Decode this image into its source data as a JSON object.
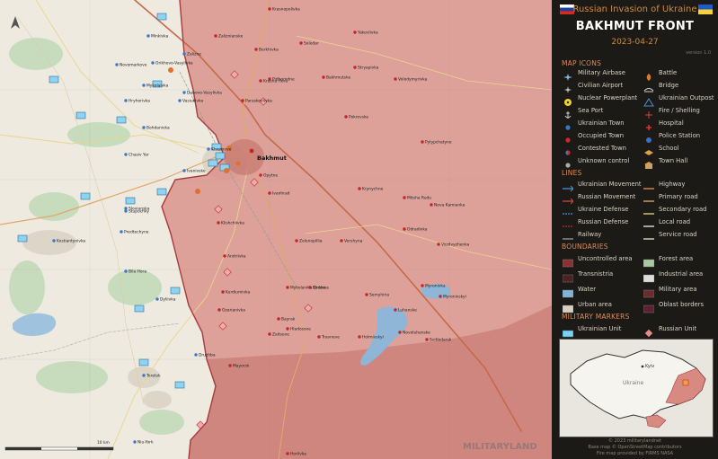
{
  "header": {
    "subtitle": "Russian Invasion of Ukraine",
    "title": "BAKHMUT FRONT",
    "date": "2023-04-27",
    "version": "version 1.0"
  },
  "legend": {
    "map_icons_heading": "MAP ICONS",
    "map_icons": [
      {
        "label": "Military Airbase",
        "icon": "airbase-icon"
      },
      {
        "label": "Battle",
        "icon": "battle-icon"
      },
      {
        "label": "Civilian Airport",
        "icon": "airport-icon"
      },
      {
        "label": "Bridge",
        "icon": "bridge-icon"
      },
      {
        "label": "Nuclear Powerplant",
        "icon": "nuclear-icon"
      },
      {
        "label": "Ukrainian Outpost",
        "icon": "outpost-icon"
      },
      {
        "label": "Sea Port",
        "icon": "anchor-icon"
      },
      {
        "label": "Fire / Shelling",
        "icon": "fire-icon"
      },
      {
        "label": "Ukrainian Town",
        "icon": "blue-dot-icon"
      },
      {
        "label": "Hospital",
        "icon": "hospital-icon"
      },
      {
        "label": "Occupied Town",
        "icon": "red-dot-icon"
      },
      {
        "label": "Police Station",
        "icon": "police-icon"
      },
      {
        "label": "Contested Town",
        "icon": "contested-dot-icon"
      },
      {
        "label": "School",
        "icon": "school-icon"
      },
      {
        "label": "Unknown control",
        "icon": "grey-dot-icon"
      },
      {
        "label": "Town Hall",
        "icon": "town-hall-icon"
      }
    ],
    "lines_heading": "LINES",
    "lines": [
      {
        "label": "Ukrainian Movement",
        "color": "#4a8fd0"
      },
      {
        "label": "Highway",
        "color": "#e8915a"
      },
      {
        "label": "Russian Movement",
        "color": "#cc4444"
      },
      {
        "label": "Primary road",
        "color": "#f0a860"
      },
      {
        "label": "Ukraine Defense",
        "color": "#4a8fd0"
      },
      {
        "label": "Secondary road",
        "color": "#e8d58a"
      },
      {
        "label": "Russian Defense",
        "color": "#b03030"
      },
      {
        "label": "Local road",
        "color": "#f0f0f0"
      },
      {
        "label": "Railway",
        "color": "#999999"
      },
      {
        "label": "Service road",
        "color": "#e8e8d0"
      }
    ],
    "boundaries_heading": "BOUNDARIES",
    "boundaries": [
      {
        "label": "Uncontrolled area",
        "color": "#8a3232"
      },
      {
        "label": "Forest area",
        "color": "#a9c7a0"
      },
      {
        "label": "Transnistria",
        "color": "#4a2222"
      },
      {
        "label": "Industrial area",
        "color": "#dcdcdc"
      },
      {
        "label": "Water",
        "color": "#7fb3d9"
      },
      {
        "label": "Military area",
        "color": "#6a2d2d"
      },
      {
        "label": "Urban area",
        "color": "#d8cfc0"
      },
      {
        "label": "Oblast borders",
        "color": "#5a2232"
      }
    ],
    "markers_heading": "MILITARY MARKERS",
    "markers": [
      {
        "label": "Ukrainian Unit",
        "color": "#7fd1f0"
      },
      {
        "label": "Russian Unit",
        "color": "#e88a8a"
      }
    ]
  },
  "footer": {
    "line1": "© 2023 militarylandnet",
    "line2": "Base map © OpenStreetMap contributors",
    "line3": "Fire map provided by FIRMS NASA"
  },
  "map": {
    "scale_label": "10 km",
    "watermark": "MILITARYLAND",
    "towns_main": [
      "Bakhmut"
    ],
    "towns_blue": [
      "Chasiv Yar",
      "Ivanivske",
      "Khromove",
      "Orikhovo-Vasylivka",
      "Dubovo-Vasylivka",
      "Mykolaivka",
      "Slovianska",
      "Kostiantynivka",
      "Predtechyne",
      "Stupochky",
      "Bila Hora",
      "Dyliivka",
      "Toretsk",
      "Druzhba",
      "Zalizne",
      "Niu-York",
      "Minkivka",
      "Novomarkove",
      "Vasiukivka",
      "Bohdanivka",
      "Hryhorivka"
    ],
    "towns_red": [
      "Zaliznianske",
      "Krasnopolivka",
      "Berkhivka",
      "Soledar",
      "Yakovlivka",
      "Pidhorodne",
      "Bakhmutske",
      "Stryapivka",
      "Volodymyrivka",
      "Krasna Hora",
      "Paraskoviivka",
      "Pokrovske",
      "Pylypchatyne",
      "Opytne",
      "Ivanhrad",
      "Klishchiivka",
      "Andriivka",
      "Kurdiumivka",
      "Ozarianivka",
      "Zaitseve",
      "Mykolaivka Druha",
      "Kodema",
      "Hladosove",
      "Travneve",
      "Bayrak",
      "Holmivskyi",
      "Novoluhanske",
      "Svitlodarsk",
      "Semyhiria",
      "Luhanske",
      "Myronivskyi",
      "Myronivka",
      "Vershyna",
      "Odradivka",
      "Nova Kamianka",
      "Vozdvyzhenka",
      "Mayorsk",
      "Horlivka",
      "Zelenopillia",
      "Mitsha Rudu",
      "Krynychne"
    ]
  },
  "inset": {
    "capital": "Kyiv",
    "label": "Ukraine"
  }
}
